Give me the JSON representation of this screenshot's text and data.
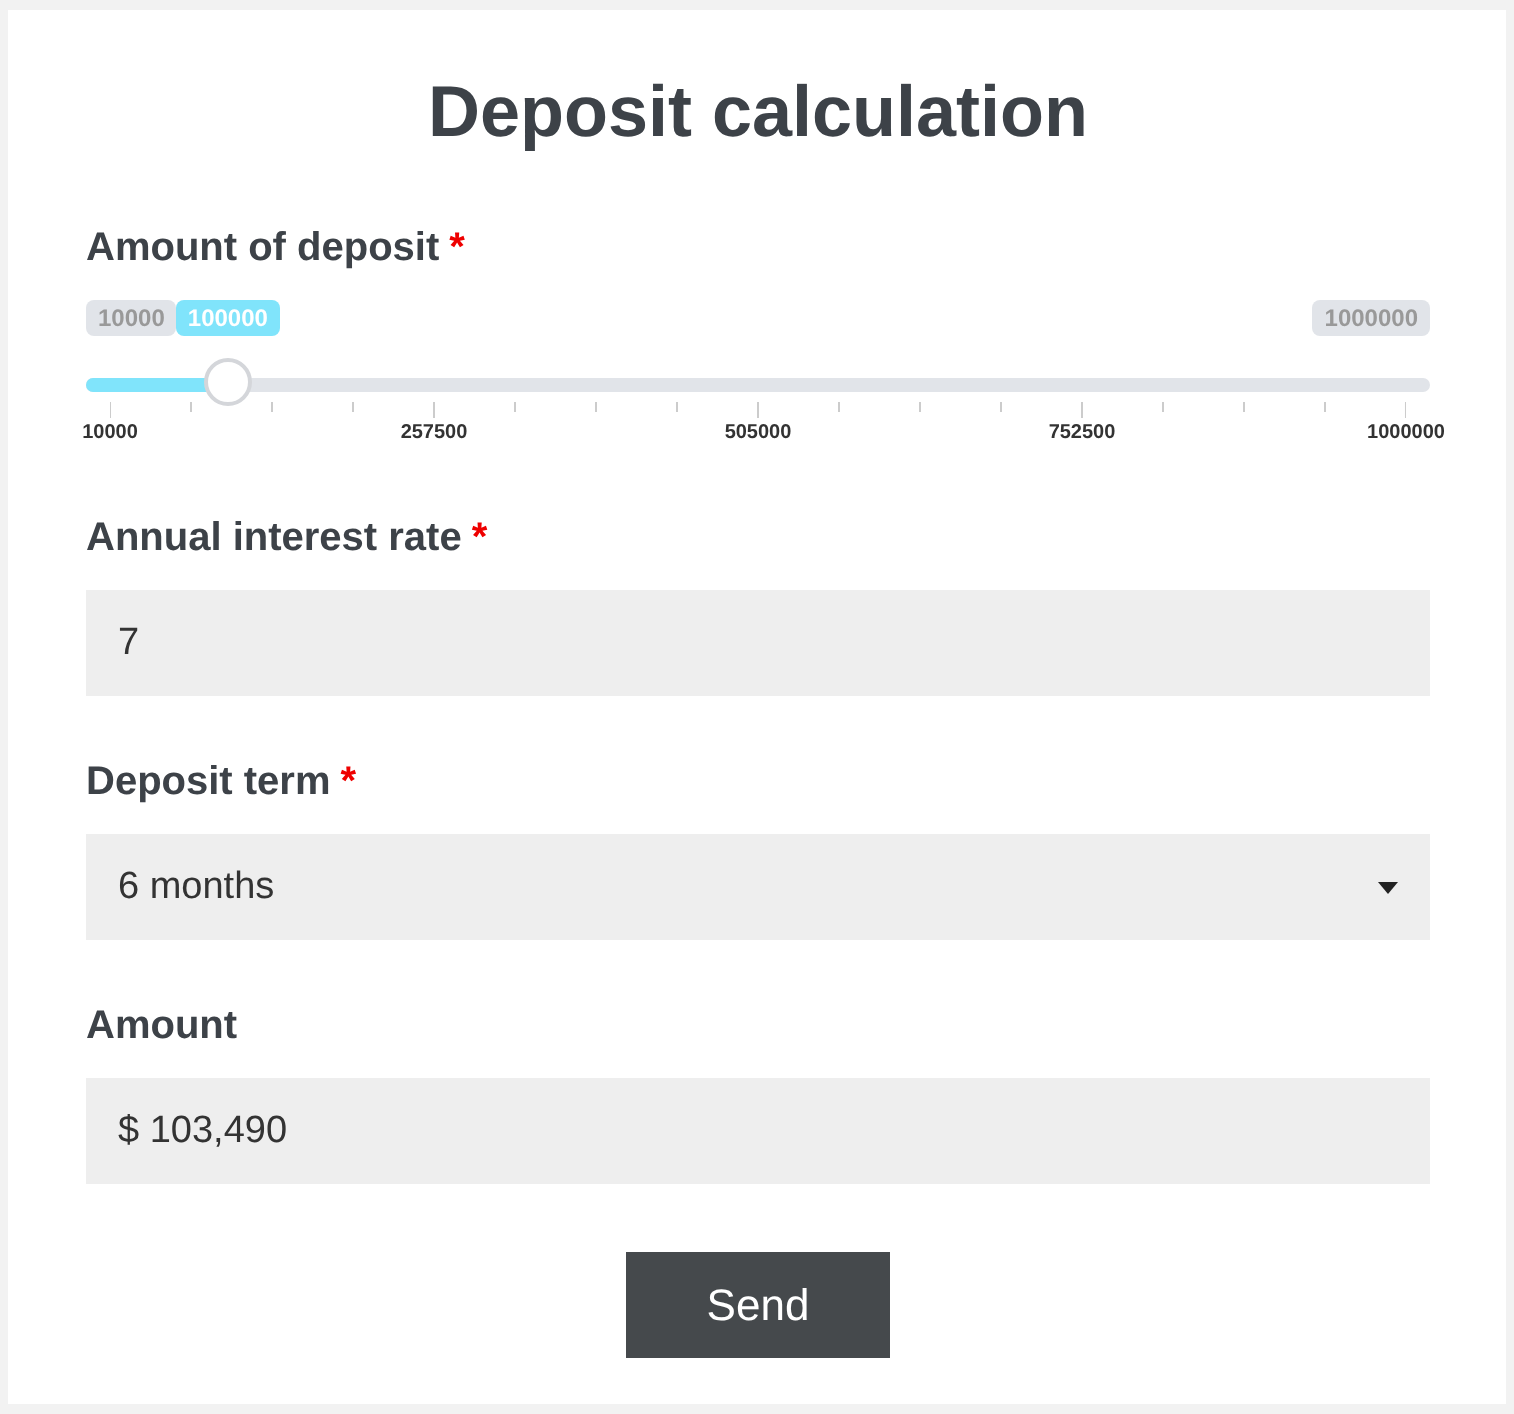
{
  "title": "Deposit calculation",
  "fields": [
    {
      "kind": "slider",
      "label": "Amount of deposit",
      "required_mark": "*",
      "min_label": "10000",
      "max_label": "1000000",
      "value_label": "100000",
      "level": 0.0909,
      "ticks": [
        "10000",
        "257500",
        "505000",
        "752500",
        "1000000"
      ]
    },
    {
      "kind": "text",
      "label": "Annual interest rate",
      "required_mark": "*",
      "value": "7"
    },
    {
      "kind": "select",
      "label": "Deposit term",
      "required_mark": "*",
      "value": "6 months"
    },
    {
      "kind": "output",
      "label": "Amount",
      "value": "$ 103,490"
    }
  ],
  "button": "Send"
}
